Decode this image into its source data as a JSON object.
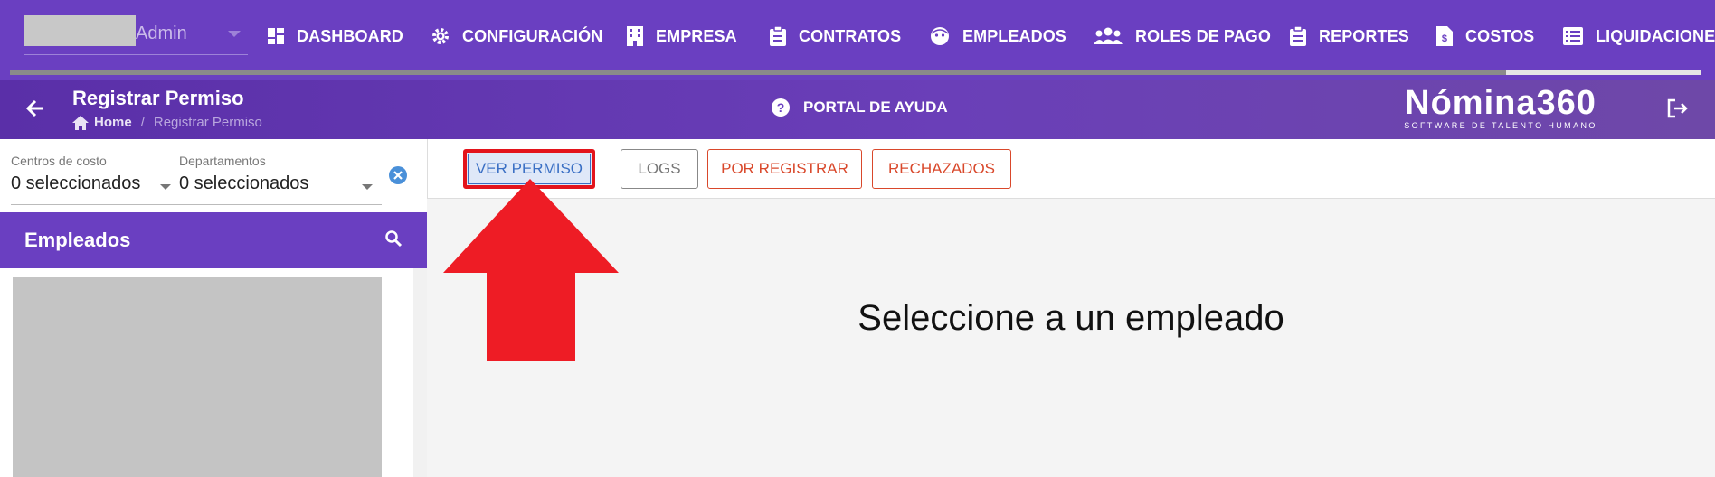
{
  "user": {
    "name": "Admin"
  },
  "nav": {
    "items": [
      {
        "label": "DASHBOARD",
        "icon": "dashboard-icon"
      },
      {
        "label": "CONFIGURACIÓN",
        "icon": "gear-icon"
      },
      {
        "label": "EMPRESA",
        "icon": "building-icon"
      },
      {
        "label": "CONTRATOS",
        "icon": "clipboard-icon"
      },
      {
        "label": "EMPLEADOS",
        "icon": "face-icon"
      },
      {
        "label": "ROLES DE PAGO",
        "icon": "people-icon"
      },
      {
        "label": "REPORTES",
        "icon": "clipboard-icon"
      },
      {
        "label": "COSTOS",
        "icon": "invoice-icon"
      },
      {
        "label": "LIQUIDACIONE",
        "icon": "list-icon"
      }
    ]
  },
  "header": {
    "title": "Registrar Permiso",
    "breadcrumb_home": "Home",
    "breadcrumb_current": "Registrar Permiso",
    "help_label": "PORTAL DE AYUDA",
    "logo_main": "Nómina360",
    "logo_sub": "SOFTWARE DE TALENTO HUMANO"
  },
  "filters": {
    "cost_centers": {
      "label": "Centros de costo",
      "value": "0 seleccionados"
    },
    "departments": {
      "label": "Departamentos",
      "value": "0 seleccionados"
    }
  },
  "employees": {
    "title": "Empleados"
  },
  "toolbar": {
    "ver_permiso": "VER PERMISO",
    "logs": "LOGS",
    "por_registrar": "POR REGISTRAR",
    "rechazados": "RECHAZADOS"
  },
  "main": {
    "empty_message": "Seleccione a un empleado"
  },
  "colors": {
    "brand": "#6a3fc1",
    "danger": "#d9482b",
    "primary": "#3a6fc4",
    "highlight": "#e3141c"
  }
}
